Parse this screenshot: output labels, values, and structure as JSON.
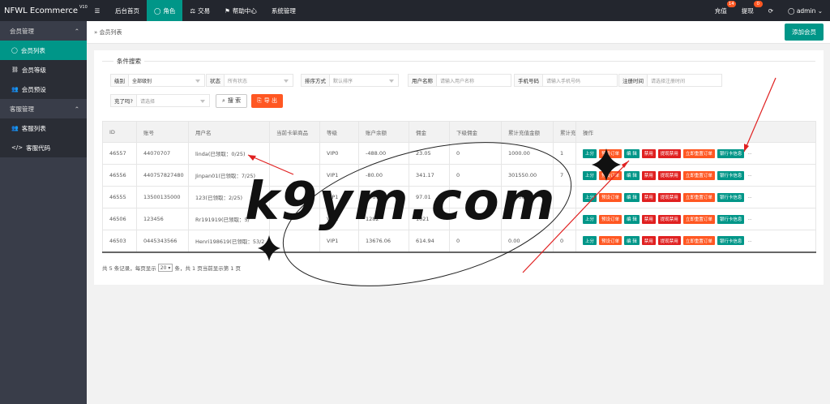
{
  "app": {
    "title": "NFWL Ecommerce",
    "version": "V10"
  },
  "topnav": {
    "menu_icon": "menu-icon",
    "items": [
      {
        "label": "后台首页"
      },
      {
        "label": "角色",
        "icon": "user-icon"
      },
      {
        "label": "交易",
        "icon": "scale-icon"
      },
      {
        "label": "帮助中心",
        "icon": "flag-icon"
      },
      {
        "label": "系统管理"
      }
    ]
  },
  "topright": {
    "recharge": {
      "label": "充值",
      "count": "14"
    },
    "withdraw": {
      "label": "提现",
      "count": "0"
    },
    "refresh_icon": "refresh-icon",
    "user": "admin"
  },
  "sidebar": {
    "groups": [
      {
        "label": "会员管理",
        "items": [
          {
            "label": "会员列表",
            "icon": "user-icon"
          },
          {
            "label": "会员等级",
            "icon": "link-icon"
          },
          {
            "label": "会员预设",
            "icon": "users-icon"
          }
        ]
      },
      {
        "label": "客服管理",
        "items": [
          {
            "label": "客服列表",
            "icon": "users-icon"
          },
          {
            "label": "客服代码",
            "icon": "code-icon"
          }
        ]
      }
    ]
  },
  "breadcrumb": {
    "text": "会员列表"
  },
  "add_button": "添加会员",
  "search": {
    "legend": "条件搜索",
    "level": {
      "label": "级别",
      "value": "全部级别"
    },
    "status": {
      "label": "状态",
      "placeholder": "所有状态"
    },
    "sort": {
      "label": "排序方式",
      "placeholder": "默认排序"
    },
    "username": {
      "label": "用户名称",
      "placeholder": "请输入用户名称"
    },
    "phone": {
      "label": "手机号码",
      "placeholder": "请输入手机号码"
    },
    "regtime": {
      "label": "注册时间",
      "placeholder": "请选择注册时间"
    },
    "charged": {
      "label": "充了吗?",
      "placeholder": "请选择"
    },
    "search_btn": "搜 索",
    "export_btn": "导 出"
  },
  "table": {
    "headers": [
      "ID",
      "账号",
      "用户名",
      "当前卡单商品",
      "等级",
      "账户余额",
      "佣金",
      "下级佣金",
      "累计充值金额",
      "累计充值",
      "操作"
    ],
    "rows": [
      {
        "id": "46557",
        "account": "44070707",
        "username": "linda(已领取：0/25)",
        "card": "",
        "level": "VIP0",
        "balance": "-488.00",
        "commission": "23.05",
        "sub": "0",
        "total": "1000.00",
        "count": "1"
      },
      {
        "id": "46556",
        "account": "440757827480",
        "username": "Jinpan01(已领取：7/25)",
        "card": "",
        "level": "VIP1",
        "balance": "-80.00",
        "commission": "341.17",
        "sub": "0",
        "total": "301550.00",
        "count": "7"
      },
      {
        "id": "46555",
        "account": "13500135000",
        "username": "123(已领取：2/25)",
        "card": "",
        "level": "VIP1",
        "balance": "1967.",
        "commission": "97.01",
        "sub": "0",
        "total": "11000.",
        "count": ""
      },
      {
        "id": "46506",
        "account": "123456",
        "username": "Rr191919(已领取：5/",
        "card": "",
        "level": "VIP2",
        "balance": "1282",
        "commission": "1021",
        "sub": "",
        "total": "",
        "count": ""
      },
      {
        "id": "46503",
        "account": "0445343566",
        "username": "Henri198619(已领取：53/2",
        "card": "",
        "level": "VIP1",
        "balance": "13676.06",
        "commission": "614.94",
        "sub": "0",
        "total": "0.00",
        "count": "0"
      }
    ],
    "ops": [
      "上分",
      "预设订单",
      "编 辑",
      "禁用",
      "提现禁用",
      "立即重置订单",
      "银行卡信息",
      "..."
    ]
  },
  "pager": {
    "prefix": "共 5 条记录，每页显示",
    "size": "20",
    "suffix": "条，共 1 页当前显示第 1 页"
  },
  "watermark": "k9ym.com"
}
